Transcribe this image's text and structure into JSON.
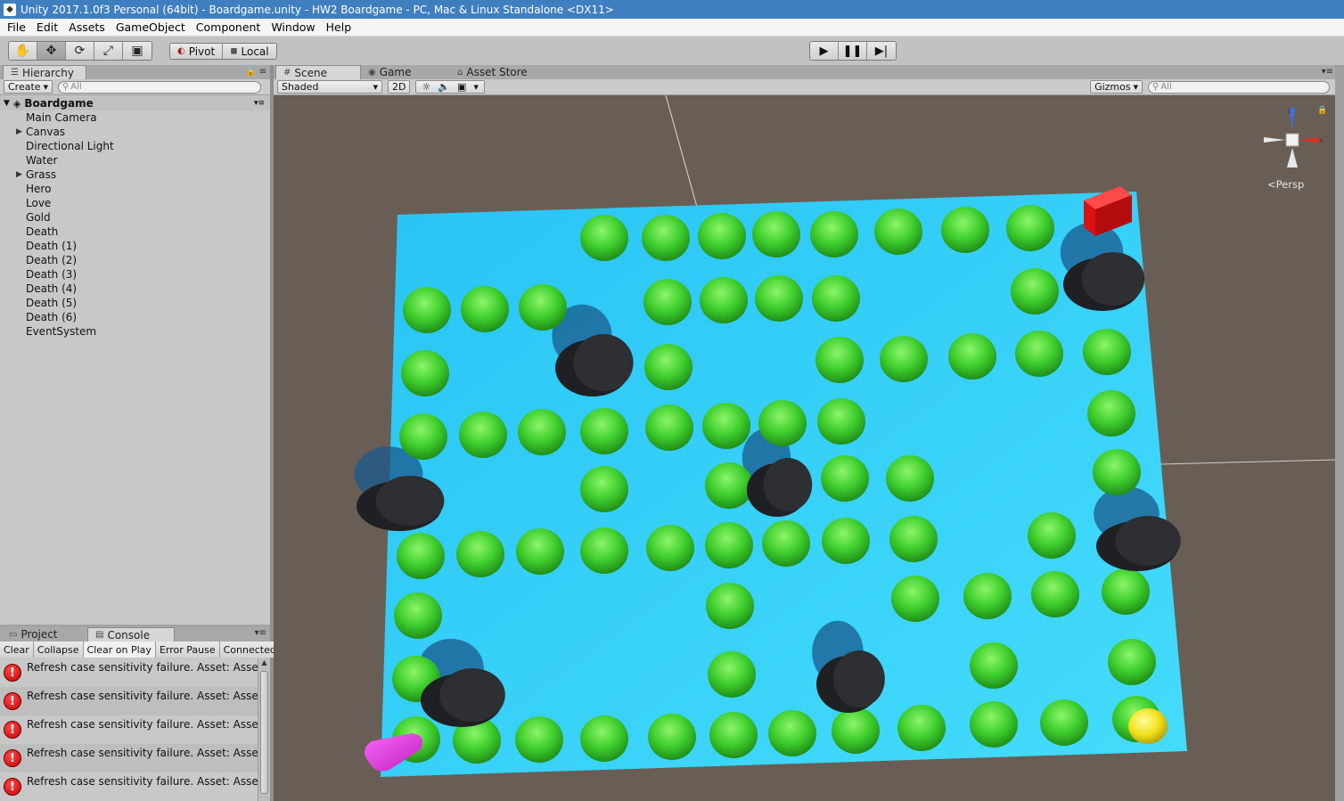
{
  "window": {
    "title": "Unity 2017.1.0f3 Personal (64bit) - Boardgame.unity - HW2 Boardgame - PC, Mac & Linux Standalone <DX11>"
  },
  "menu": [
    "File",
    "Edit",
    "Assets",
    "GameObject",
    "Component",
    "Window",
    "Help"
  ],
  "toolbar": {
    "pivot_label": "Pivot",
    "local_label": "Local"
  },
  "hierarchy": {
    "tab_label": "Hierarchy",
    "create_label": "Create",
    "search_placeholder": "All",
    "scene_name": "Boardgame",
    "items": [
      {
        "name": "Main Camera",
        "expandable": false
      },
      {
        "name": "Canvas",
        "expandable": true
      },
      {
        "name": "Directional Light",
        "expandable": false
      },
      {
        "name": "Water",
        "expandable": false
      },
      {
        "name": "Grass",
        "expandable": true
      },
      {
        "name": "Hero",
        "expandable": false
      },
      {
        "name": "Love",
        "expandable": false
      },
      {
        "name": "Gold",
        "expandable": false
      },
      {
        "name": "Death",
        "expandable": false
      },
      {
        "name": "Death (1)",
        "expandable": false
      },
      {
        "name": "Death (2)",
        "expandable": false
      },
      {
        "name": "Death (3)",
        "expandable": false
      },
      {
        "name": "Death (4)",
        "expandable": false
      },
      {
        "name": "Death (5)",
        "expandable": false
      },
      {
        "name": "Death (6)",
        "expandable": false
      },
      {
        "name": "EventSystem",
        "expandable": false
      }
    ]
  },
  "scene_tabs": {
    "scene_label": "Scene",
    "game_label": "Game",
    "store_label": "Asset Store",
    "shading_mode": "Shaded",
    "mode_2d": "2D",
    "gizmos_label": "Gizmos",
    "search_placeholder": "All",
    "persp_label": "Persp",
    "axis_z": "z",
    "axis_x": "x"
  },
  "console": {
    "project_tab": "Project",
    "console_tab": "Console",
    "buttons": [
      "Clear",
      "Collapse",
      "Clear on Play",
      "Error Pause",
      "Connected"
    ],
    "messages": [
      "Refresh case sensitivity failure. Asset: Assets",
      "Refresh case sensitivity failure. Asset: Assets",
      "Refresh case sensitivity failure. Asset: Assets",
      "Refresh case sensitivity failure. Asset: Assets",
      "Refresh case sensitivity failure. Asset: Assets"
    ]
  },
  "colors": {
    "board": "#2cc6f7",
    "grass": "#3fce2e",
    "death": "#2d2f33",
    "hero": "#e02be0",
    "love": "#e81717",
    "gold": "#f2e21a",
    "background": "#695e55"
  }
}
